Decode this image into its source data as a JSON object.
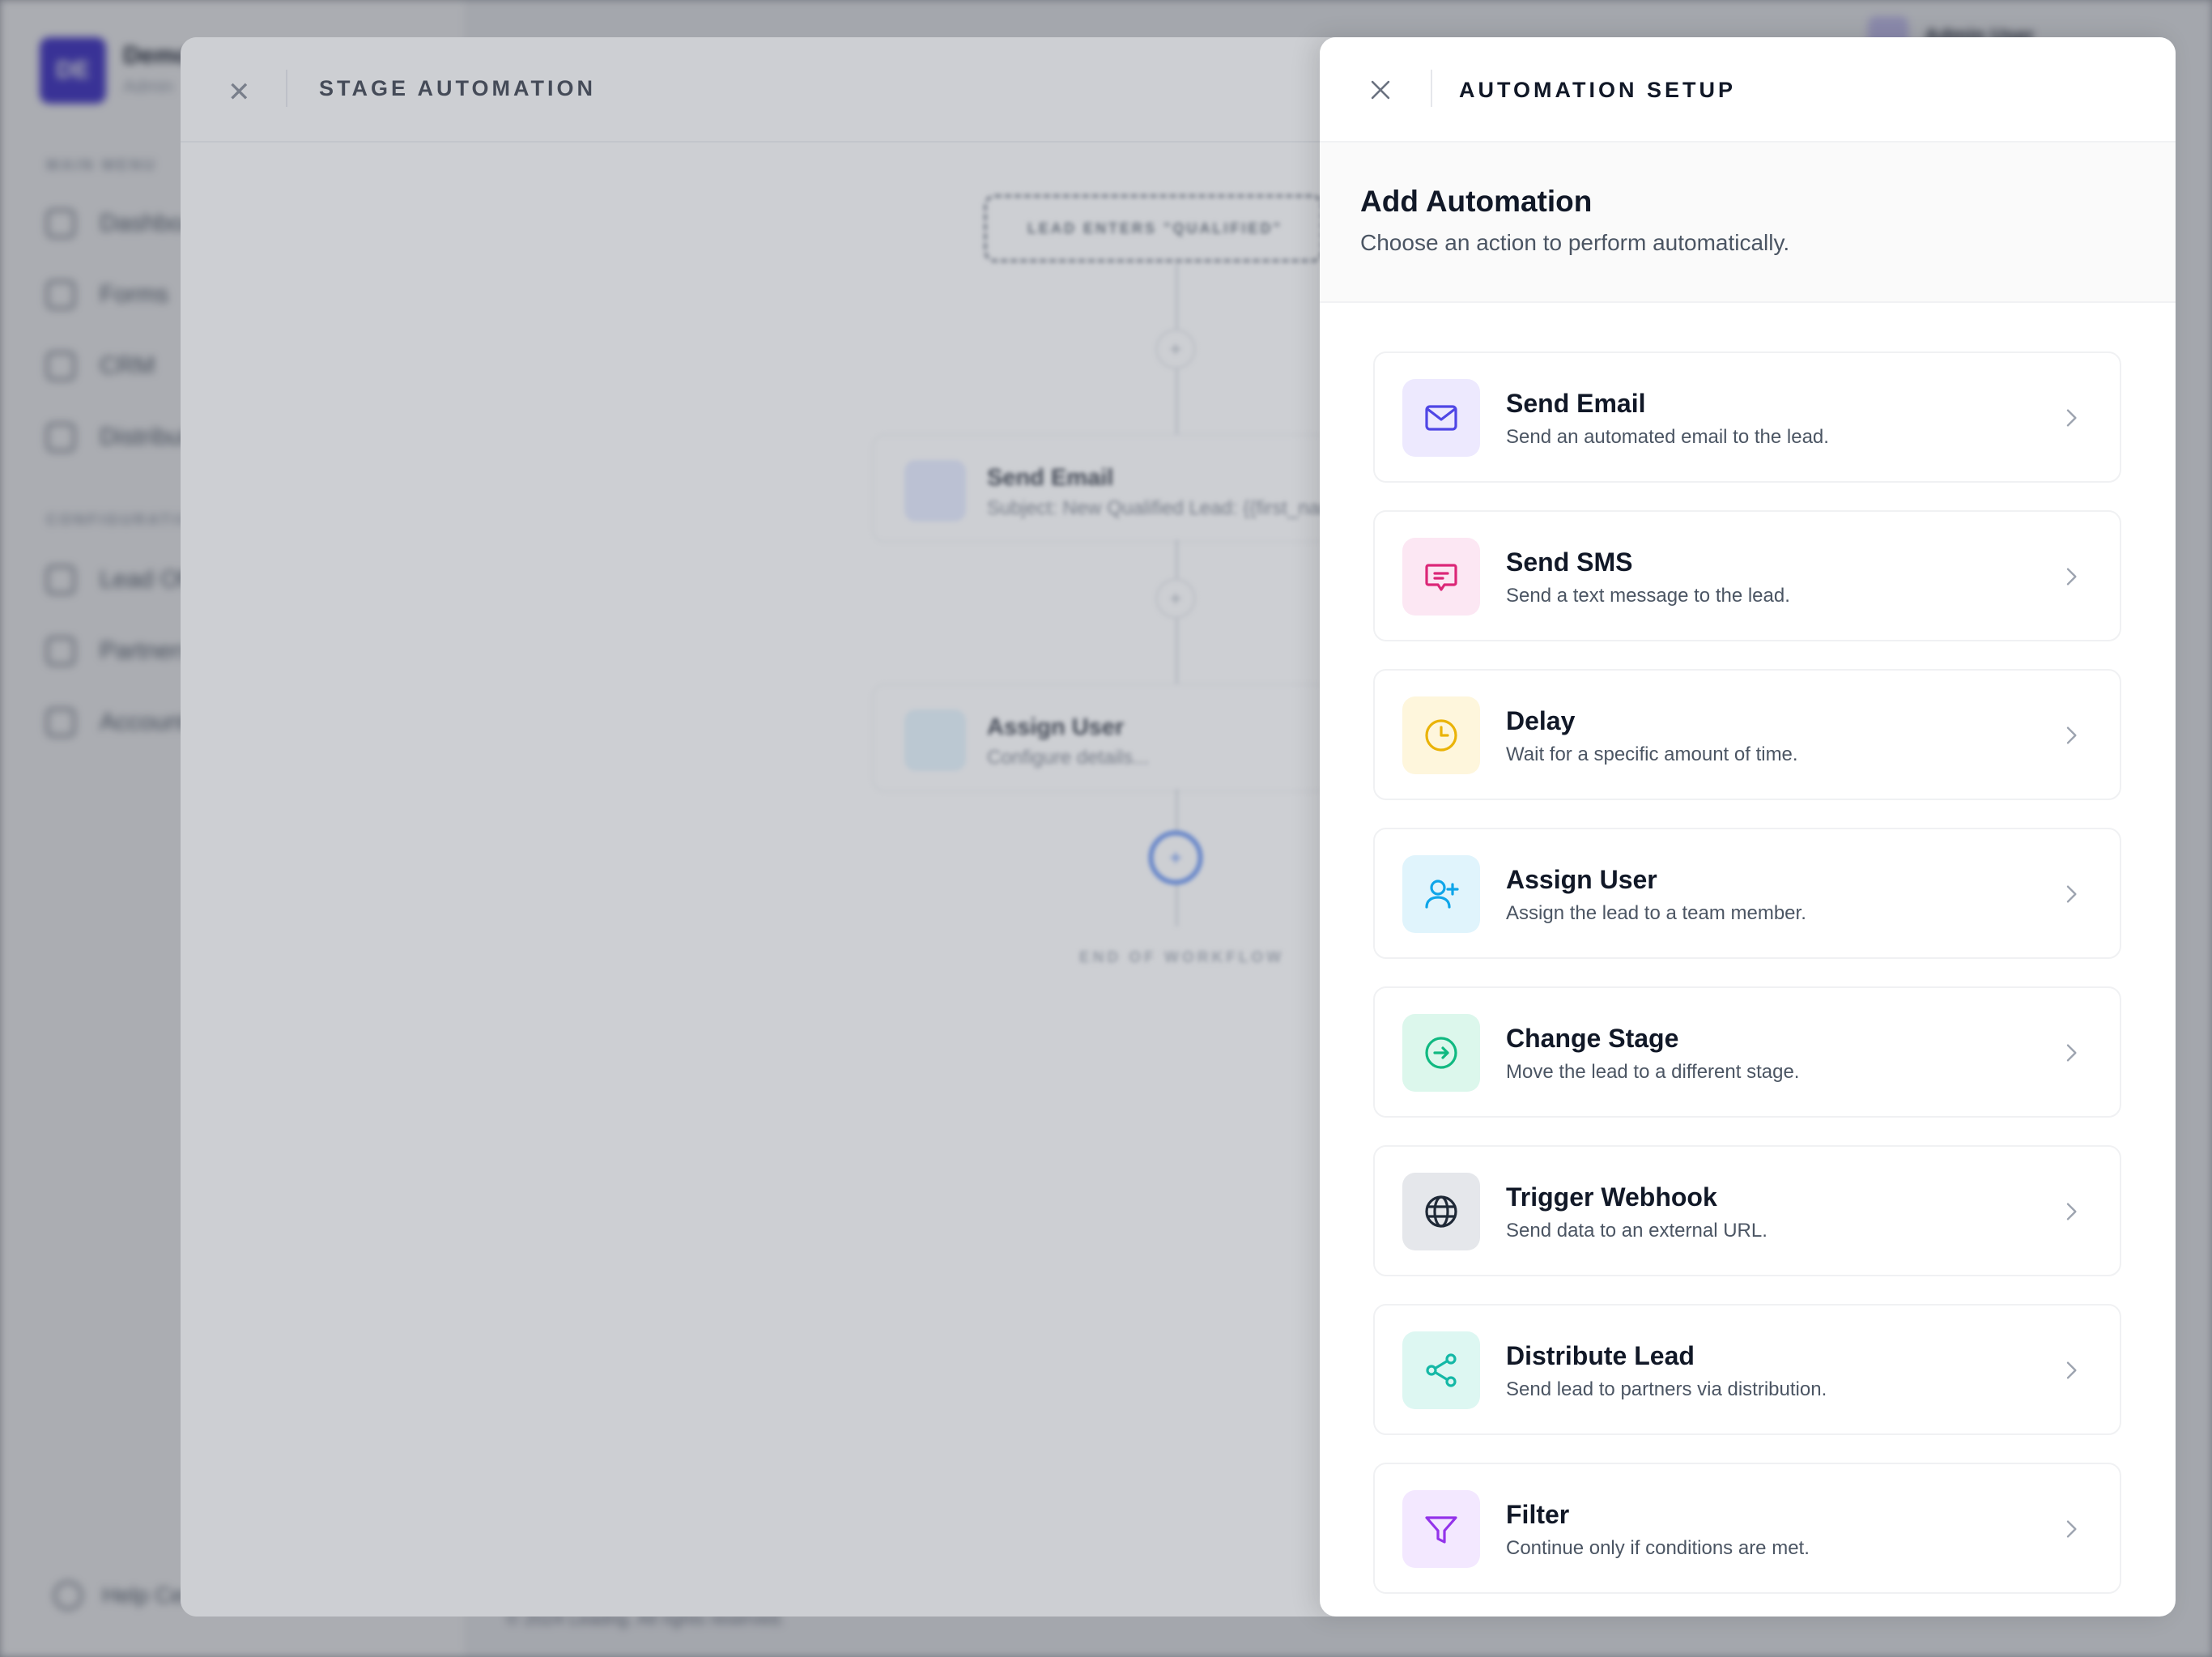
{
  "background_app": {
    "logo_initials": "DE",
    "brand_name": "Demo",
    "brand_sub": "Admin",
    "section_main": "MAIN MENU",
    "section_config": "CONFIGURATION",
    "nav": [
      "Dashboard",
      "Forms",
      "CRM",
      "Distribution",
      "Lead Offers",
      "Partners",
      "Account"
    ],
    "help": "Help Center",
    "user_name": "Admin User",
    "footer": "© 2024 Leadrig. All rights reserved."
  },
  "stage_modal": {
    "title": "STAGE AUTOMATION",
    "trigger": "LEAD ENTERS \"QUALIFIED\"",
    "steps": [
      {
        "title": "Send Email",
        "sub": "Subject: New Qualified Lead: {{first_name}}",
        "icon": "mail-icon",
        "color": "#6366f1"
      },
      {
        "title": "Assign User",
        "sub": "Configure details...",
        "icon": "user-plus-icon",
        "color": "#0ea5e9"
      }
    ],
    "end_label": "END OF WORKFLOW"
  },
  "panel": {
    "title": "AUTOMATION SETUP",
    "heading": "Add Automation",
    "subheading": "Choose an action to perform automatically.",
    "options": [
      {
        "title": "Send Email",
        "desc": "Send an automated email to the lead.",
        "icon": "mail-icon",
        "fg": "#4f46e5",
        "bg": "#ede9fe"
      },
      {
        "title": "Send SMS",
        "desc": "Send a text message to the lead.",
        "icon": "message-icon",
        "fg": "#db2777",
        "bg": "#fce7f3"
      },
      {
        "title": "Delay",
        "desc": "Wait for a specific amount of time.",
        "icon": "clock-icon",
        "fg": "#eab308",
        "bg": "#fef6dc"
      },
      {
        "title": "Assign User",
        "desc": "Assign the lead to a team member.",
        "icon": "user-plus-icon",
        "fg": "#0ea5e9",
        "bg": "#e0f4fc"
      },
      {
        "title": "Change Stage",
        "desc": "Move the lead to a different stage.",
        "icon": "arrow-circle-icon",
        "fg": "#10b981",
        "bg": "#dcf7ec"
      },
      {
        "title": "Trigger Webhook",
        "desc": "Send data to an external URL.",
        "icon": "globe-icon",
        "fg": "#1f2937",
        "bg": "#e5e7eb"
      },
      {
        "title": "Distribute Lead",
        "desc": "Send lead to partners via distribution.",
        "icon": "share-icon",
        "fg": "#14b8a6",
        "bg": "#ddf7f2"
      },
      {
        "title": "Filter",
        "desc": "Continue only if conditions are met.",
        "icon": "filter-icon",
        "fg": "#9333ea",
        "bg": "#f3e8ff"
      }
    ]
  }
}
